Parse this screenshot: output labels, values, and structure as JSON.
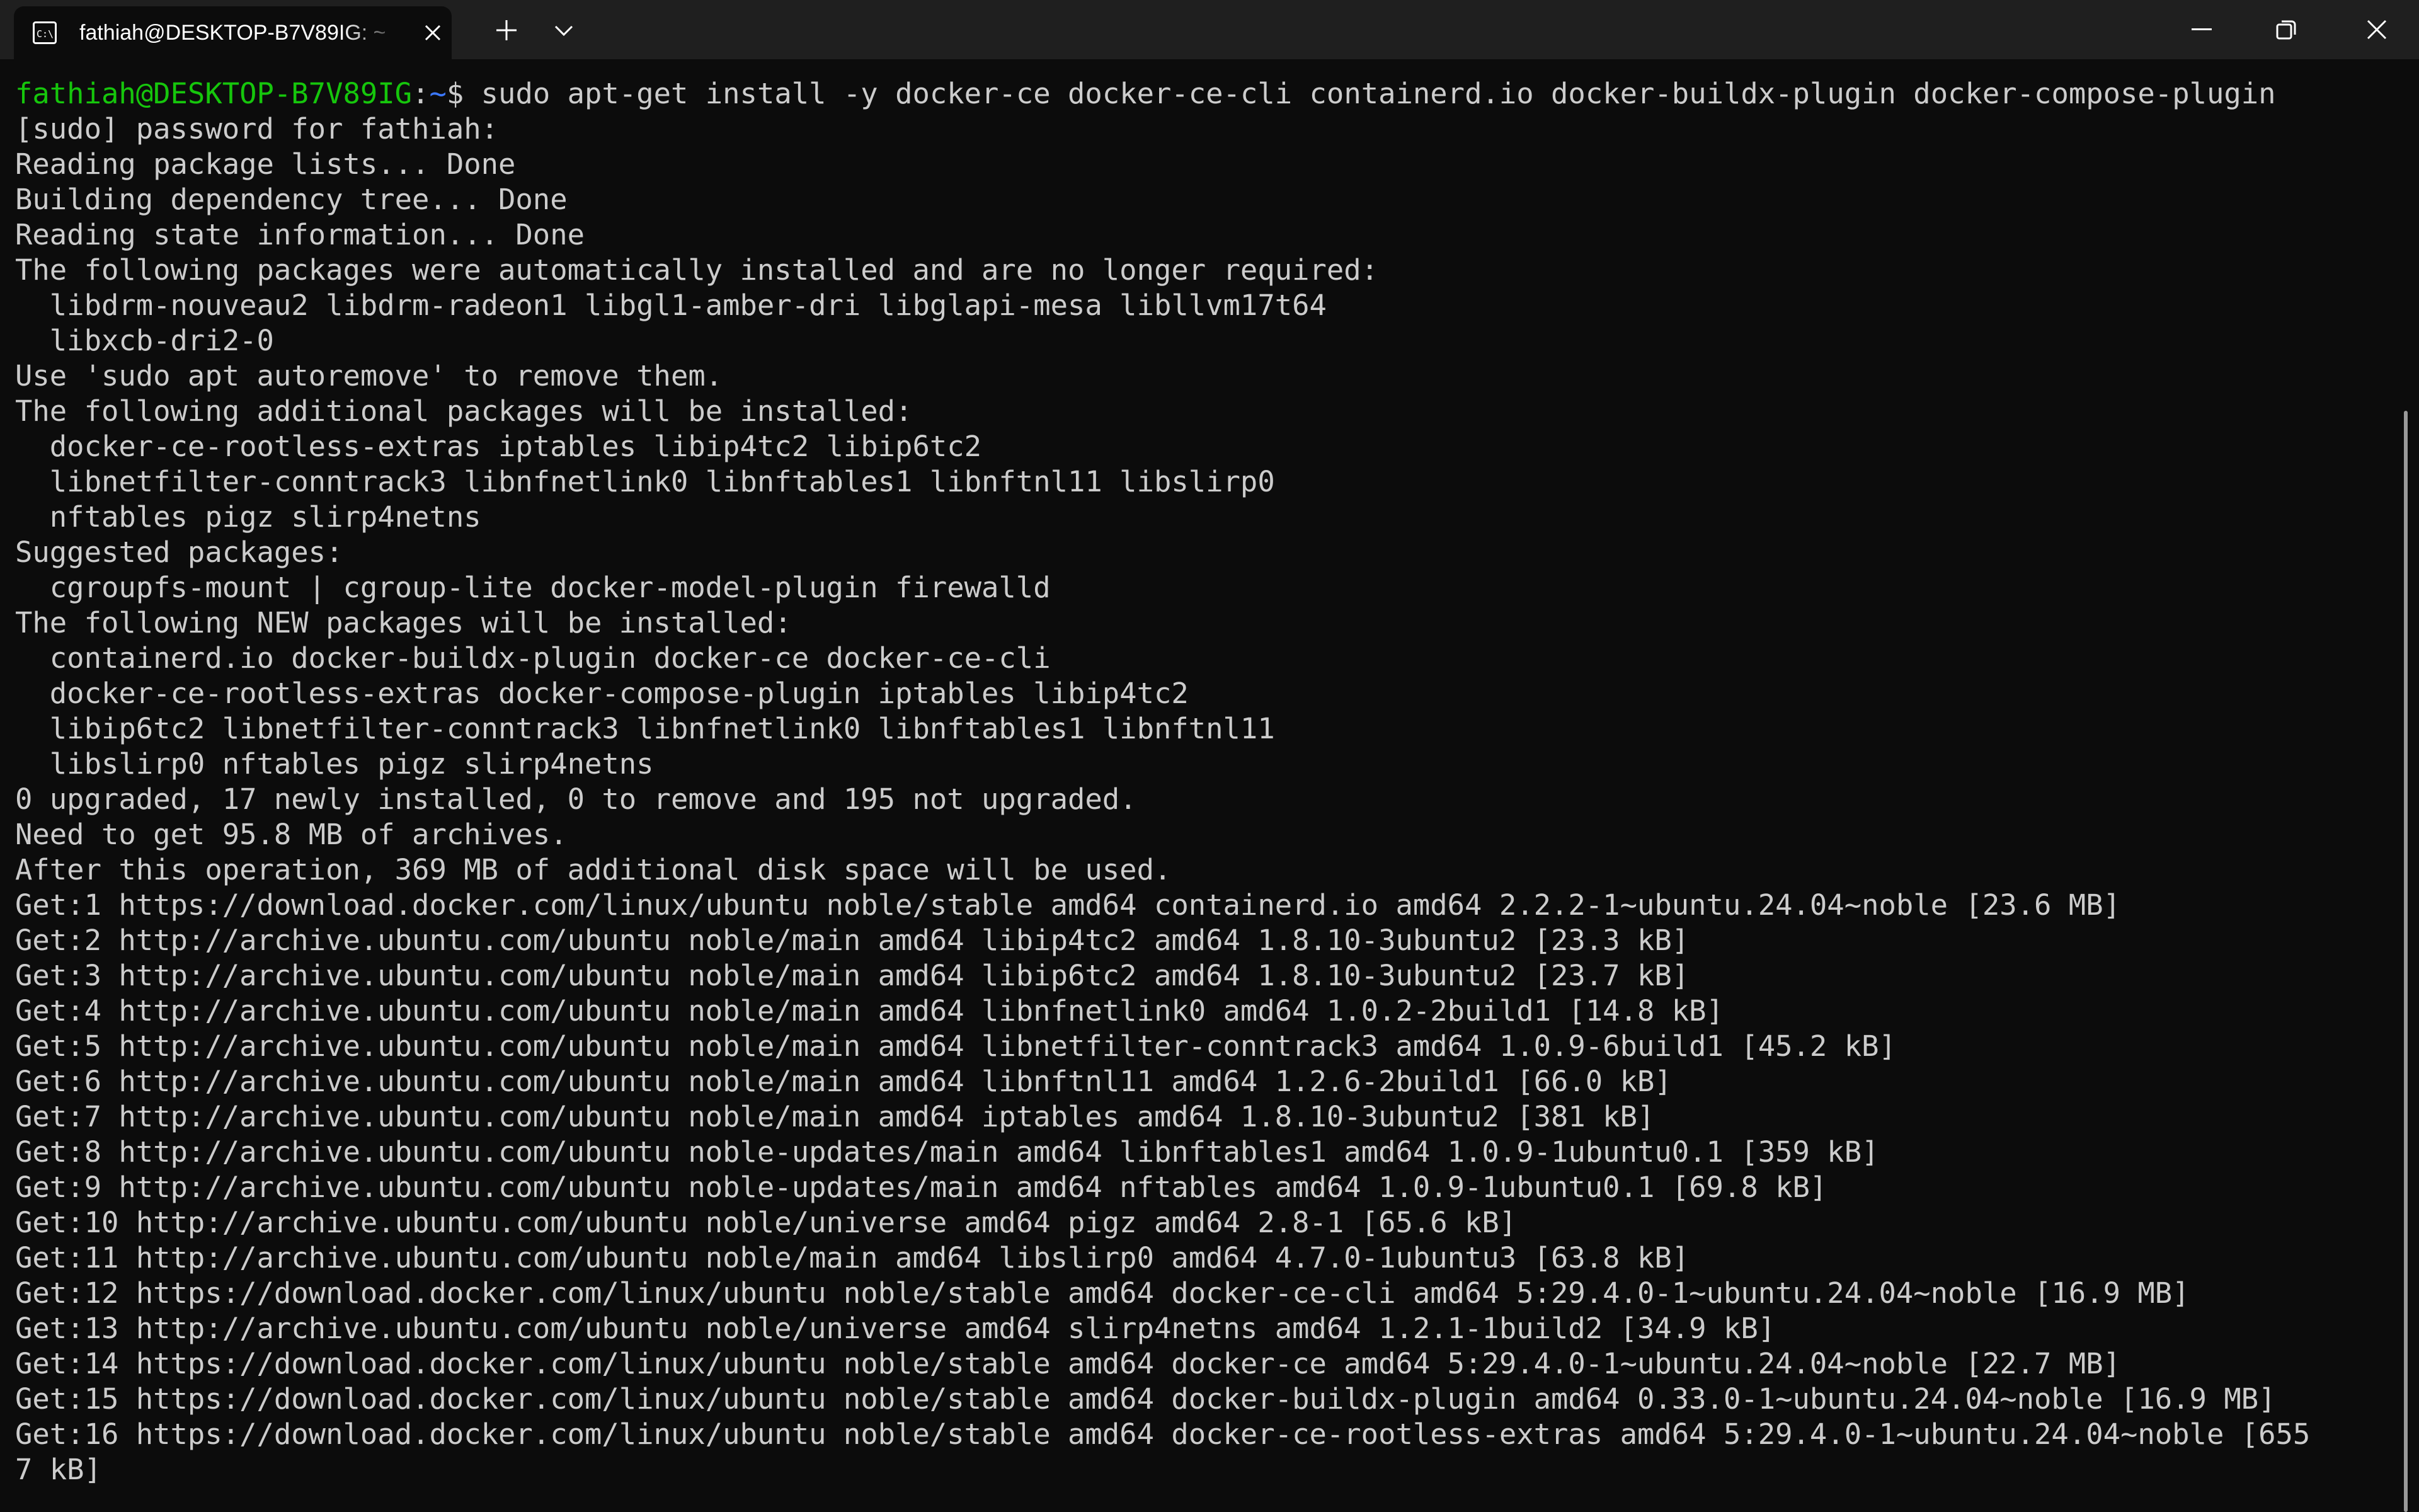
{
  "window": {
    "tab_title": "fathiah@DESKTOP-B7V89IG: ~",
    "tab_icon": "terminal-icon"
  },
  "colors": {
    "background": "#0c0c0c",
    "titlebar": "#1f1f1f",
    "text": "#cccccc",
    "prompt_user": "#16c60c",
    "prompt_path": "#3b78ff"
  },
  "prompt": {
    "user_host": "fathiah@DESKTOP-B7V89IG",
    "separator": ":",
    "path": "~",
    "symbol": "$ ",
    "command": "sudo apt-get install -y docker-ce docker-ce-cli containerd.io docker-buildx-plugin docker-compose-plugin"
  },
  "output": [
    "[sudo] password for fathiah:",
    "Reading package lists... Done",
    "Building dependency tree... Done",
    "Reading state information... Done",
    "The following packages were automatically installed and are no longer required:",
    "  libdrm-nouveau2 libdrm-radeon1 libgl1-amber-dri libglapi-mesa libllvm17t64",
    "  libxcb-dri2-0",
    "Use 'sudo apt autoremove' to remove them.",
    "The following additional packages will be installed:",
    "  docker-ce-rootless-extras iptables libip4tc2 libip6tc2",
    "  libnetfilter-conntrack3 libnfnetlink0 libnftables1 libnftnl11 libslirp0",
    "  nftables pigz slirp4netns",
    "Suggested packages:",
    "  cgroupfs-mount | cgroup-lite docker-model-plugin firewalld",
    "The following NEW packages will be installed:",
    "  containerd.io docker-buildx-plugin docker-ce docker-ce-cli",
    "  docker-ce-rootless-extras docker-compose-plugin iptables libip4tc2",
    "  libip6tc2 libnetfilter-conntrack3 libnfnetlink0 libnftables1 libnftnl11",
    "  libslirp0 nftables pigz slirp4netns",
    "0 upgraded, 17 newly installed, 0 to remove and 195 not upgraded.",
    "Need to get 95.8 MB of archives.",
    "After this operation, 369 MB of additional disk space will be used.",
    "Get:1 https://download.docker.com/linux/ubuntu noble/stable amd64 containerd.io amd64 2.2.2-1~ubuntu.24.04~noble [23.6 MB]",
    "Get:2 http://archive.ubuntu.com/ubuntu noble/main amd64 libip4tc2 amd64 1.8.10-3ubuntu2 [23.3 kB]",
    "Get:3 http://archive.ubuntu.com/ubuntu noble/main amd64 libip6tc2 amd64 1.8.10-3ubuntu2 [23.7 kB]",
    "Get:4 http://archive.ubuntu.com/ubuntu noble/main amd64 libnfnetlink0 amd64 1.0.2-2build1 [14.8 kB]",
    "Get:5 http://archive.ubuntu.com/ubuntu noble/main amd64 libnetfilter-conntrack3 amd64 1.0.9-6build1 [45.2 kB]",
    "Get:6 http://archive.ubuntu.com/ubuntu noble/main amd64 libnftnl11 amd64 1.2.6-2build1 [66.0 kB]",
    "Get:7 http://archive.ubuntu.com/ubuntu noble/main amd64 iptables amd64 1.8.10-3ubuntu2 [381 kB]",
    "Get:8 http://archive.ubuntu.com/ubuntu noble-updates/main amd64 libnftables1 amd64 1.0.9-1ubuntu0.1 [359 kB]",
    "Get:9 http://archive.ubuntu.com/ubuntu noble-updates/main amd64 nftables amd64 1.0.9-1ubuntu0.1 [69.8 kB]",
    "Get:10 http://archive.ubuntu.com/ubuntu noble/universe amd64 pigz amd64 2.8-1 [65.6 kB]",
    "Get:11 http://archive.ubuntu.com/ubuntu noble/main amd64 libslirp0 amd64 4.7.0-1ubuntu3 [63.8 kB]",
    "Get:12 https://download.docker.com/linux/ubuntu noble/stable amd64 docker-ce-cli amd64 5:29.4.0-1~ubuntu.24.04~noble [16.9 MB]",
    "Get:13 http://archive.ubuntu.com/ubuntu noble/universe amd64 slirp4netns amd64 1.2.1-1build2 [34.9 kB]",
    "Get:14 https://download.docker.com/linux/ubuntu noble/stable amd64 docker-ce amd64 5:29.4.0-1~ubuntu.24.04~noble [22.7 MB]",
    "Get:15 https://download.docker.com/linux/ubuntu noble/stable amd64 docker-buildx-plugin amd64 0.33.0-1~ubuntu.24.04~noble [16.9 MB]",
    "Get:16 https://download.docker.com/linux/ubuntu noble/stable amd64 docker-ce-rootless-extras amd64 5:29.4.0-1~ubuntu.24.04~noble [655",
    "7 kB]"
  ]
}
